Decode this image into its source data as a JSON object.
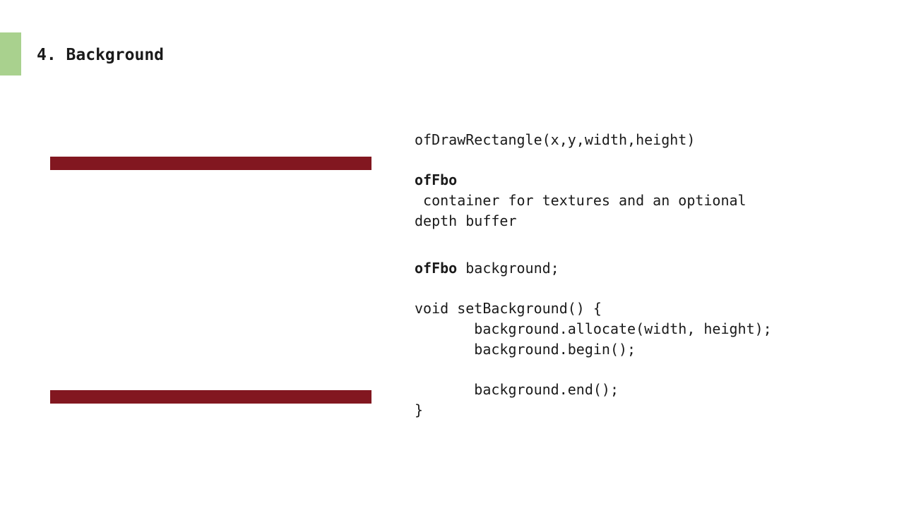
{
  "slide": {
    "title": "4. Background",
    "accent_color": "#a9d18e",
    "band_color": "#821720"
  },
  "content": {
    "draw_rect_signature": "ofDrawRectangle(x,y,width,height)",
    "fbo_heading": "ofFbo",
    "fbo_desc_line1": " container for textures and an optional",
    "fbo_desc_line2": "depth buffer",
    "decl_keyword": "ofFbo",
    "decl_rest": " background;",
    "func_open": "void setBackground() {",
    "allocate_line": "       background.allocate(width, height);",
    "begin_line": "       background.begin();",
    "end_line": "       background.end();",
    "func_close": "}"
  }
}
